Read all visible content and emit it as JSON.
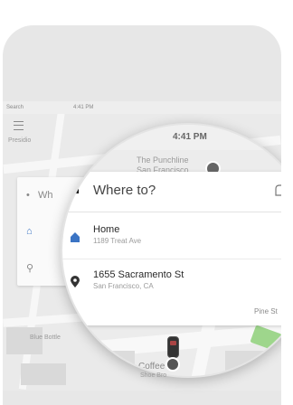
{
  "status_bar": {
    "carrier": "Search",
    "time": "4:41 PM"
  },
  "map": {
    "poi_small": "Presidio",
    "poi_label": "The Punchline\nSan Francisco",
    "street_pine": "Pine St",
    "street_coffee": "Coffee",
    "street_blue": "Blue Bottle",
    "street_bottom": "Shoe Bro"
  },
  "search_card": {
    "where_to": "Where to?",
    "where_to_small": "Wh"
  },
  "saved_places": [
    {
      "title": "Home",
      "subtitle": "1189 Treat Ave"
    },
    {
      "title": "1655 Sacramento St",
      "subtitle": "San Francisco, CA"
    }
  ],
  "colors": {
    "phone_bg": "#e7e7e7",
    "map_bg": "#eaeaea",
    "home_icon": "#3b74c4",
    "pin_icon": "#333333",
    "park": "#9ed68c"
  },
  "icons": {
    "menu": "hamburger-icon",
    "where": "car-seat-icon",
    "home": "home-icon",
    "place": "location-pin-icon"
  }
}
